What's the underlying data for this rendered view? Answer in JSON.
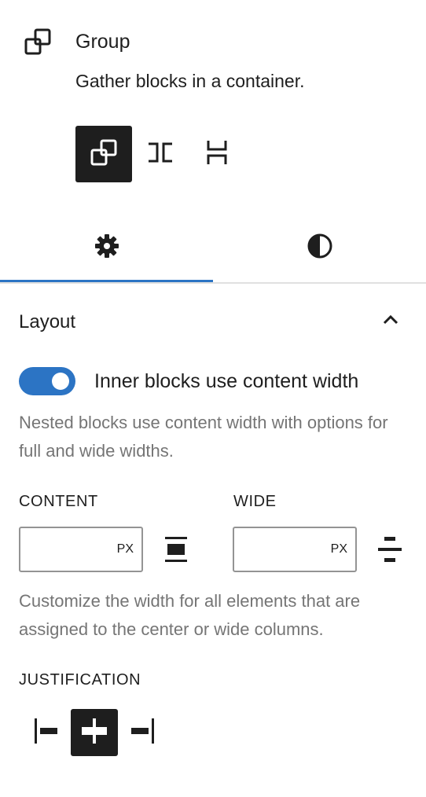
{
  "block": {
    "icon": "group-icon",
    "title": "Group",
    "description": "Gather blocks in a container."
  },
  "variations": [
    {
      "name": "group",
      "icon": "group-icon",
      "active": true
    },
    {
      "name": "row",
      "icon": "row-icon",
      "active": false
    },
    {
      "name": "stack",
      "icon": "stack-icon",
      "active": false
    }
  ],
  "tabs": [
    {
      "name": "settings",
      "icon": "gear-icon",
      "active": true
    },
    {
      "name": "styles",
      "icon": "half-circle-icon",
      "active": false
    }
  ],
  "layout_panel": {
    "title": "Layout",
    "expanded": true,
    "toggle": {
      "label": "Inner blocks use content width",
      "checked": true,
      "help": "Nested blocks use content width with options for full and wide widths."
    },
    "content": {
      "label": "CONTENT",
      "value": "",
      "unit": "PX",
      "icon": "content-width-icon"
    },
    "wide": {
      "label": "WIDE",
      "value": "",
      "unit": "PX",
      "icon": "wide-width-icon"
    },
    "width_help": "Customize the width for all elements that are assigned to the center or wide columns.",
    "justification": {
      "label": "JUSTIFICATION",
      "options": [
        {
          "name": "left",
          "icon": "justify-left-icon",
          "active": false
        },
        {
          "name": "center",
          "icon": "justify-center-icon",
          "active": true
        },
        {
          "name": "right",
          "icon": "justify-right-icon",
          "active": false
        }
      ]
    }
  },
  "colors": {
    "accent": "#2c74c4",
    "text": "#1e1e1e",
    "muted": "#757575",
    "divider": "#e0e0e0"
  }
}
